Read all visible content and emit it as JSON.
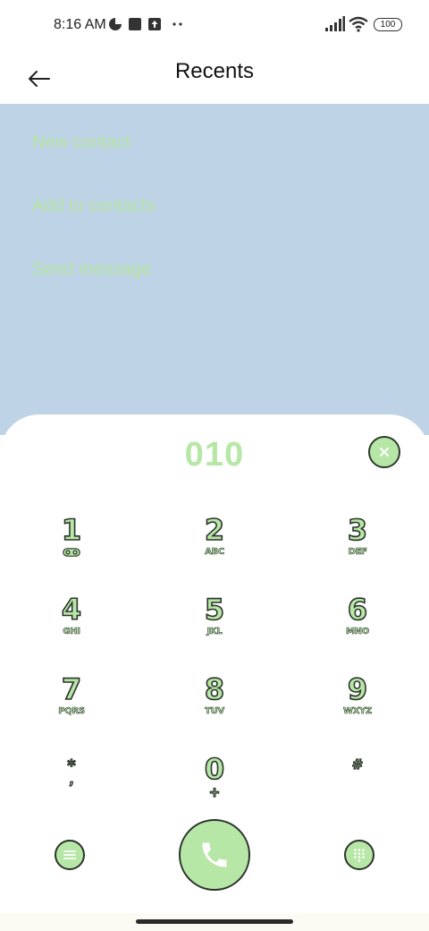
{
  "status_bar": {
    "time": "8:16 AM",
    "battery": "100",
    "icons": [
      "data-saver-icon",
      "square-icon",
      "upload-icon",
      "more-dots-icon",
      "signal-icon",
      "wifi-icon",
      "battery-icon"
    ]
  },
  "app_bar": {
    "title": "Recents",
    "back_icon": "arrow-left-icon"
  },
  "menu": {
    "items": [
      {
        "label": "New contact"
      },
      {
        "label": "Add to contacts"
      },
      {
        "label": "Send message"
      }
    ]
  },
  "dialer": {
    "number": "010",
    "keys": [
      {
        "digit": "1",
        "letters": ""
      },
      {
        "digit": "2",
        "letters": "ABC"
      },
      {
        "digit": "3",
        "letters": "DEF"
      },
      {
        "digit": "4",
        "letters": "GHI"
      },
      {
        "digit": "5",
        "letters": "JKL"
      },
      {
        "digit": "6",
        "letters": "MNO"
      },
      {
        "digit": "7",
        "letters": "PQRS"
      },
      {
        "digit": "8",
        "letters": "TUV"
      },
      {
        "digit": "9",
        "letters": "WXYZ"
      },
      {
        "digit": "*",
        "letters": ","
      },
      {
        "digit": "0",
        "letters": "+"
      },
      {
        "digit": "#",
        "letters": ""
      }
    ]
  },
  "colors": {
    "accent": "#b7e7a6",
    "outline": "#2b332b",
    "overlay": "#bfd3e6"
  }
}
